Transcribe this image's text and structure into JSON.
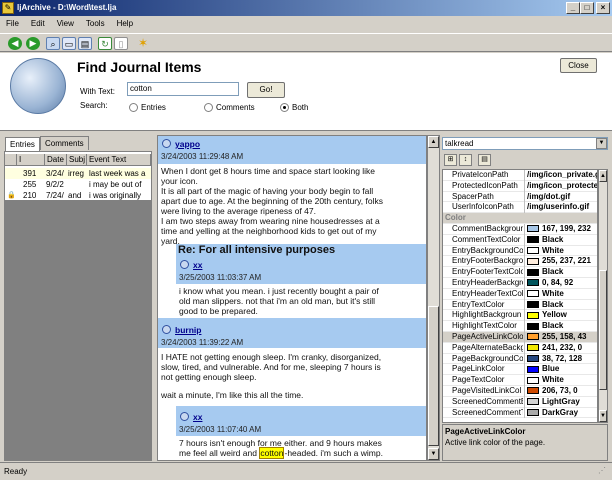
{
  "window": {
    "title": "ljArchive - D:\\Word\\test.lja"
  },
  "menu": [
    "File",
    "Edit",
    "View",
    "Tools",
    "Help"
  ],
  "header": {
    "title": "Find Journal Items",
    "with_text_label": "With Text:",
    "search_value": "cotton",
    "go_label": "Go!",
    "search_label": "Search:",
    "options": [
      "Entries",
      "Comments",
      "Both"
    ],
    "selected_option": "Both",
    "close_label": "Close"
  },
  "left": {
    "tabs": [
      "Entries",
      "Comments"
    ],
    "columns": [
      "I",
      "Date",
      "Subj",
      "Event Text"
    ],
    "rows": [
      {
        "id": "391",
        "date": "3/24/",
        "subj": "irreg",
        "text": "last week was a"
      },
      {
        "id": "255",
        "date": "9/2/2",
        "subj": "",
        "text": "i may be out of"
      },
      {
        "id": "210",
        "date": "7/24/",
        "subj": "and",
        "text": "i was originally"
      }
    ]
  },
  "content": {
    "post1_user": "yappo",
    "post1_time": "3/24/2003 11:29:48 AM",
    "post1_text": [
      "When I dont get 8 hours time and space start looking like",
      "your icon.",
      "It is all part of the magic of having your body begin to fall",
      "apart due to age. At the beginning of the 20th century, folks",
      "were living to the average ripeness of 47.",
      "I am two steps away from wearing nine housedresses at a",
      "time and yelling at the neighborhood kids to get out of my",
      "yard."
    ],
    "reply1_subject": "Re: For all intensive purposes",
    "reply1_user": "xx",
    "reply1_time": "3/25/2003 11:03:37 AM",
    "reply1_text": [
      "i know what you mean. i just recently bought a pair of",
      "old man slippers. not that i'm an old man, but it's still",
      "good to be prepared."
    ],
    "post2_user": "burnip",
    "post2_time": "3/24/2003 11:39:22 AM",
    "post2_text": [
      "I HATE not getting enough sleep. I'm cranky, disorganized,",
      "slow, tired, and vulnerable. And for me, sleeping 7 hours is",
      "not getting enough sleep."
    ],
    "post2_text2": "wait a minute, I'm like this all the time.",
    "reply2_user": "xx",
    "reply2_time": "3/25/2003 11:07:40 AM",
    "reply2_line1": "7 hours isn't enough for me either. and 9 hours makes",
    "reply2_pre": "me feel all weird and ",
    "reply2_hl": "cotton",
    "reply2_post": "-headed. i'm such a wimp."
  },
  "props": {
    "combo_value": "talkread",
    "rows": [
      {
        "name": "PrivateIconPath",
        "value": "/img/icon_private.g",
        "swatch": ""
      },
      {
        "name": "ProtectedIconPath",
        "value": "/img/icon_protecte",
        "swatch": ""
      },
      {
        "name": "SpacerPath",
        "value": "/img/dot.gif",
        "swatch": ""
      },
      {
        "name": "UserInfoIconPath",
        "value": "/img/userinfo.gif",
        "swatch": ""
      },
      {
        "name": "Color",
        "value": "",
        "swatch": "",
        "category": true
      },
      {
        "name": "CommentBackgroun",
        "value": "167, 199, 232",
        "swatch": "#a7c7e8"
      },
      {
        "name": "CommentTextColor",
        "value": "Black",
        "swatch": "#000000"
      },
      {
        "name": "EntryBackgroundCol",
        "value": "White",
        "swatch": "#ffffff"
      },
      {
        "name": "EntryFooterBackgro",
        "value": "255, 237, 221",
        "swatch": "#ffeddd"
      },
      {
        "name": "EntryFooterTextColo",
        "value": "Black",
        "swatch": "#000000"
      },
      {
        "name": "EntryHeaderBackgro",
        "value": "0, 84, 92",
        "swatch": "#00545c"
      },
      {
        "name": "EntryHeaderTextColo",
        "value": "White",
        "swatch": "#ffffff"
      },
      {
        "name": "EntryTextColor",
        "value": "Black",
        "swatch": "#000000"
      },
      {
        "name": "HighlightBackgroun",
        "value": "Yellow",
        "swatch": "#ffff00"
      },
      {
        "name": "HighlightTextColor",
        "value": "Black",
        "swatch": "#000000"
      },
      {
        "name": "PageActiveLinkColor",
        "value": "255, 158, 43",
        "swatch": "#ff9e2b",
        "selected": true
      },
      {
        "name": "PageAlternateBackg",
        "value": "241, 232, 0",
        "swatch": "#f1e800"
      },
      {
        "name": "PageBackgroundCo",
        "value": "38, 72, 128",
        "swatch": "#264880"
      },
      {
        "name": "PageLinkColor",
        "value": "Blue",
        "swatch": "#0000ff"
      },
      {
        "name": "PageTextColor",
        "value": "White",
        "swatch": "#ffffff"
      },
      {
        "name": "PageVisitedLinkCol",
        "value": "206, 73, 0",
        "swatch": "#ce4900"
      },
      {
        "name": "ScreenedCommentB",
        "value": "LightGray",
        "swatch": "#d3d3d3"
      },
      {
        "name": "ScreenedCommentT",
        "value": "DarkGray",
        "swatch": "#a9a9a9"
      }
    ],
    "desc_title": "PageActiveLinkColor",
    "desc_text": "Active link color of the page."
  },
  "status": "Ready"
}
